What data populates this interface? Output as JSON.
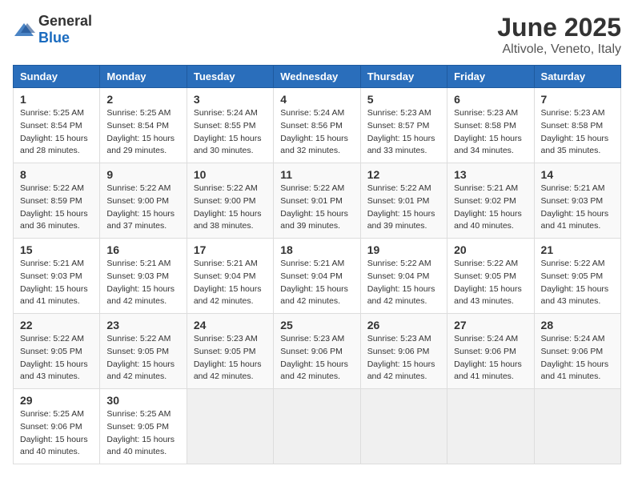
{
  "header": {
    "logo_general": "General",
    "logo_blue": "Blue",
    "title": "June 2025",
    "subtitle": "Altivole, Veneto, Italy"
  },
  "calendar": {
    "days_of_week": [
      "Sunday",
      "Monday",
      "Tuesday",
      "Wednesday",
      "Thursday",
      "Friday",
      "Saturday"
    ],
    "weeks": [
      [
        {
          "day": "",
          "info": ""
        },
        {
          "day": "2",
          "info": "Sunrise: 5:25 AM\nSunset: 8:54 PM\nDaylight: 15 hours\nand 29 minutes."
        },
        {
          "day": "3",
          "info": "Sunrise: 5:24 AM\nSunset: 8:55 PM\nDaylight: 15 hours\nand 30 minutes."
        },
        {
          "day": "4",
          "info": "Sunrise: 5:24 AM\nSunset: 8:56 PM\nDaylight: 15 hours\nand 32 minutes."
        },
        {
          "day": "5",
          "info": "Sunrise: 5:23 AM\nSunset: 8:57 PM\nDaylight: 15 hours\nand 33 minutes."
        },
        {
          "day": "6",
          "info": "Sunrise: 5:23 AM\nSunset: 8:58 PM\nDaylight: 15 hours\nand 34 minutes."
        },
        {
          "day": "7",
          "info": "Sunrise: 5:23 AM\nSunset: 8:58 PM\nDaylight: 15 hours\nand 35 minutes."
        }
      ],
      [
        {
          "day": "1",
          "info": "Sunrise: 5:25 AM\nSunset: 8:54 PM\nDaylight: 15 hours\nand 28 minutes."
        },
        {
          "day": "",
          "info": ""
        },
        {
          "day": "",
          "info": ""
        },
        {
          "day": "",
          "info": ""
        },
        {
          "day": "",
          "info": ""
        },
        {
          "day": "",
          "info": ""
        },
        {
          "day": "",
          "info": ""
        }
      ],
      [
        {
          "day": "8",
          "info": "Sunrise: 5:22 AM\nSunset: 8:59 PM\nDaylight: 15 hours\nand 36 minutes."
        },
        {
          "day": "9",
          "info": "Sunrise: 5:22 AM\nSunset: 9:00 PM\nDaylight: 15 hours\nand 37 minutes."
        },
        {
          "day": "10",
          "info": "Sunrise: 5:22 AM\nSunset: 9:00 PM\nDaylight: 15 hours\nand 38 minutes."
        },
        {
          "day": "11",
          "info": "Sunrise: 5:22 AM\nSunset: 9:01 PM\nDaylight: 15 hours\nand 39 minutes."
        },
        {
          "day": "12",
          "info": "Sunrise: 5:22 AM\nSunset: 9:01 PM\nDaylight: 15 hours\nand 39 minutes."
        },
        {
          "day": "13",
          "info": "Sunrise: 5:21 AM\nSunset: 9:02 PM\nDaylight: 15 hours\nand 40 minutes."
        },
        {
          "day": "14",
          "info": "Sunrise: 5:21 AM\nSunset: 9:03 PM\nDaylight: 15 hours\nand 41 minutes."
        }
      ],
      [
        {
          "day": "15",
          "info": "Sunrise: 5:21 AM\nSunset: 9:03 PM\nDaylight: 15 hours\nand 41 minutes."
        },
        {
          "day": "16",
          "info": "Sunrise: 5:21 AM\nSunset: 9:03 PM\nDaylight: 15 hours\nand 42 minutes."
        },
        {
          "day": "17",
          "info": "Sunrise: 5:21 AM\nSunset: 9:04 PM\nDaylight: 15 hours\nand 42 minutes."
        },
        {
          "day": "18",
          "info": "Sunrise: 5:21 AM\nSunset: 9:04 PM\nDaylight: 15 hours\nand 42 minutes."
        },
        {
          "day": "19",
          "info": "Sunrise: 5:22 AM\nSunset: 9:04 PM\nDaylight: 15 hours\nand 42 minutes."
        },
        {
          "day": "20",
          "info": "Sunrise: 5:22 AM\nSunset: 9:05 PM\nDaylight: 15 hours\nand 43 minutes."
        },
        {
          "day": "21",
          "info": "Sunrise: 5:22 AM\nSunset: 9:05 PM\nDaylight: 15 hours\nand 43 minutes."
        }
      ],
      [
        {
          "day": "22",
          "info": "Sunrise: 5:22 AM\nSunset: 9:05 PM\nDaylight: 15 hours\nand 43 minutes."
        },
        {
          "day": "23",
          "info": "Sunrise: 5:22 AM\nSunset: 9:05 PM\nDaylight: 15 hours\nand 42 minutes."
        },
        {
          "day": "24",
          "info": "Sunrise: 5:23 AM\nSunset: 9:05 PM\nDaylight: 15 hours\nand 42 minutes."
        },
        {
          "day": "25",
          "info": "Sunrise: 5:23 AM\nSunset: 9:06 PM\nDaylight: 15 hours\nand 42 minutes."
        },
        {
          "day": "26",
          "info": "Sunrise: 5:23 AM\nSunset: 9:06 PM\nDaylight: 15 hours\nand 42 minutes."
        },
        {
          "day": "27",
          "info": "Sunrise: 5:24 AM\nSunset: 9:06 PM\nDaylight: 15 hours\nand 41 minutes."
        },
        {
          "day": "28",
          "info": "Sunrise: 5:24 AM\nSunset: 9:06 PM\nDaylight: 15 hours\nand 41 minutes."
        }
      ],
      [
        {
          "day": "29",
          "info": "Sunrise: 5:25 AM\nSunset: 9:06 PM\nDaylight: 15 hours\nand 40 minutes."
        },
        {
          "day": "30",
          "info": "Sunrise: 5:25 AM\nSunset: 9:05 PM\nDaylight: 15 hours\nand 40 minutes."
        },
        {
          "day": "",
          "info": ""
        },
        {
          "day": "",
          "info": ""
        },
        {
          "day": "",
          "info": ""
        },
        {
          "day": "",
          "info": ""
        },
        {
          "day": "",
          "info": ""
        }
      ]
    ]
  }
}
